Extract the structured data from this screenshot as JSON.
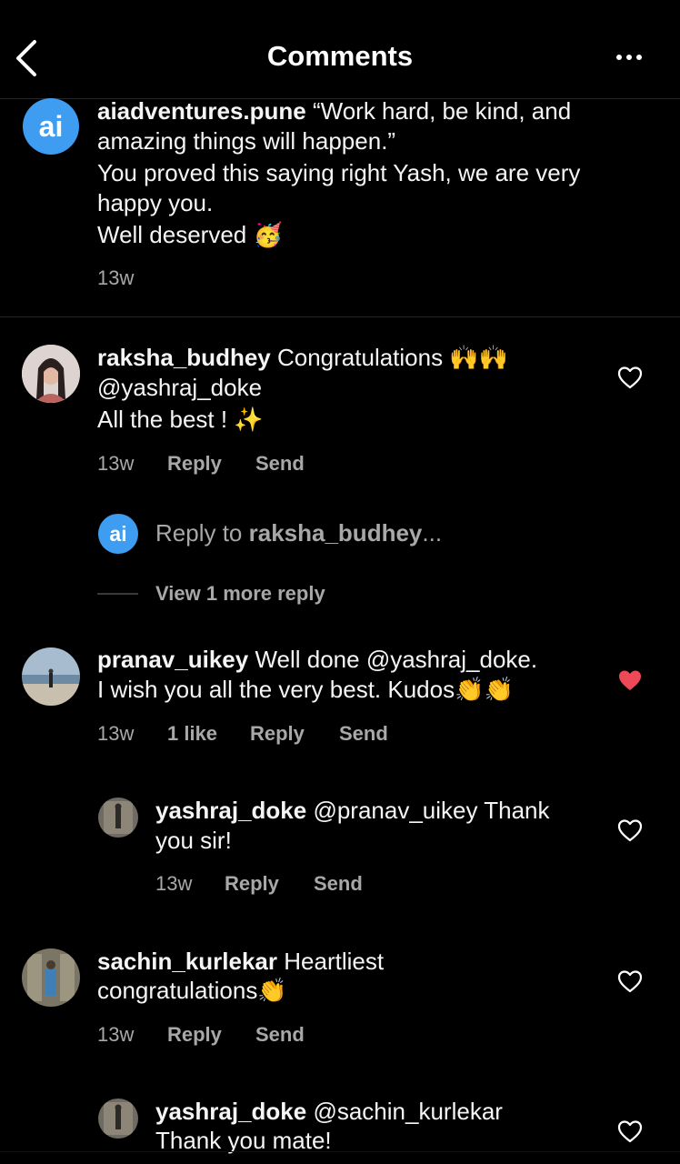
{
  "header": {
    "title": "Comments"
  },
  "caption": {
    "username": "aiadventures.pune",
    "line1": "“Work hard, be kind, and",
    "line2": "amazing things will happen.”",
    "line3": "You proved this saying right Yash, we are very",
    "line4": "happy you.",
    "line5": "Well deserved",
    "emoji": "🥳",
    "time": "13w"
  },
  "comments": [
    {
      "username": "raksha_budhey",
      "text1": "Congratulations",
      "emoji1": "🙌🙌",
      "line2": "@yashraj_doke",
      "line3": "All the best !",
      "emoji3": "✨",
      "time": "13w",
      "reply_label": "Reply",
      "send_label": "Send",
      "reply_prompt_prefix": "Reply to",
      "reply_prompt_user": "raksha_budhey",
      "reply_prompt_suffix": "...",
      "view_more": "View 1 more reply"
    },
    {
      "username": "pranav_uikey",
      "text1": "Well done @yashraj_doke.",
      "line2": "I wish you all the very best. Kudos",
      "emoji2": "👏👏",
      "time": "13w",
      "likes": "1 like",
      "reply_label": "Reply",
      "send_label": "Send",
      "liked": true
    },
    {
      "username": "yashraj_doke",
      "text1": "@pranav_uikey Thank",
      "line2": "you sir!",
      "time": "13w",
      "reply_label": "Reply",
      "send_label": "Send"
    },
    {
      "username": "sachin_kurlekar",
      "text1": "Heartliest",
      "line2": "congratulations",
      "emoji2": "👏",
      "time": "13w",
      "reply_label": "Reply",
      "send_label": "Send"
    },
    {
      "username": "yashraj_doke",
      "text1": "@sachin_kurlekar",
      "line2": "Thank you mate!"
    }
  ],
  "colors": {
    "background": "#000000",
    "ai_blue": "#3e9cf1",
    "like_red": "#ed4956",
    "muted": "#a8a8a8"
  },
  "icons": [
    "back-arrow-icon",
    "more-options-icon",
    "heart-icon",
    "heart-filled-icon"
  ]
}
